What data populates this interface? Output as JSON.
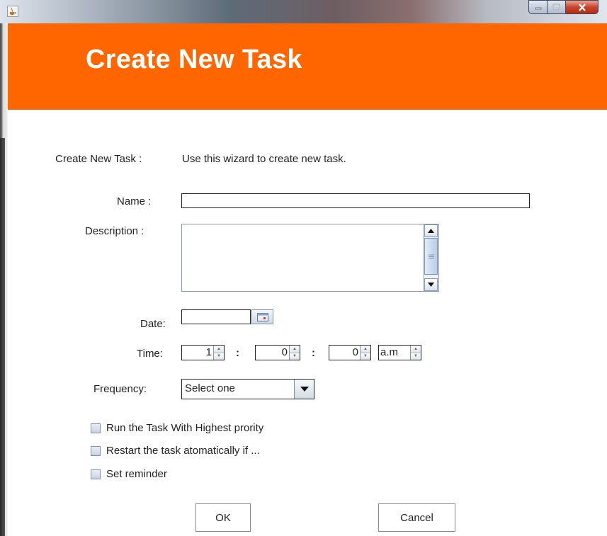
{
  "window": {
    "title_icon": "java-cup-icon",
    "controls": [
      "minimize-icon",
      "maximize-icon",
      "close-icon"
    ]
  },
  "header": {
    "title": "Create New Task",
    "background_color": "#ff6600"
  },
  "form": {
    "intro_label": "Create New Task :",
    "intro_text": "Use this wizard to create new task.",
    "name_label": "Name :",
    "name_value": "",
    "description_label": "Description :",
    "description_value": "",
    "date_label": "Date:",
    "date_value": "",
    "time_label": "Time:",
    "time": {
      "hour": "1",
      "minute": "0",
      "second": "0",
      "period": "a.m",
      "separator": ":"
    },
    "frequency_label": "Frequency:",
    "frequency_selected": "Select one"
  },
  "options": [
    {
      "label": "Run the Task With Highest prority",
      "checked": false
    },
    {
      "label": "Restart the task atomatically if ...",
      "checked": false
    },
    {
      "label": "Set reminder",
      "checked": false
    }
  ],
  "buttons": {
    "ok": "OK",
    "cancel": "Cancel"
  }
}
